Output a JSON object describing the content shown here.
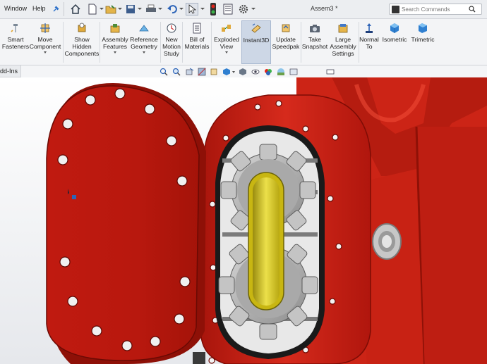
{
  "menu": {
    "window_label": "Window",
    "help_label": "Help"
  },
  "document": {
    "title": "Assem3 *"
  },
  "search": {
    "placeholder": "Search Commands"
  },
  "commands": [
    {
      "label": "Smart\nFasteners",
      "icon": "smart-fasteners-icon"
    },
    {
      "label": "Move\nComponent",
      "icon": "move-component-icon"
    },
    {
      "label": "Show\nHidden\nComponents",
      "icon": "show-hidden-components-icon"
    },
    {
      "label": "Assembly\nFeatures",
      "icon": "assembly-features-icon"
    },
    {
      "label": "Reference\nGeometry",
      "icon": "reference-geometry-icon"
    },
    {
      "label": "New\nMotion\nStudy",
      "icon": "motion-study-icon"
    },
    {
      "label": "Bill of\nMaterials",
      "icon": "bill-of-materials-icon"
    },
    {
      "label": "Exploded\nView",
      "icon": "exploded-view-icon"
    },
    {
      "label": "Instant3D",
      "icon": "instant3d-icon"
    },
    {
      "label": "Update\nSpeedpak",
      "icon": "update-speedpak-icon"
    },
    {
      "label": "Take\nSnapshot",
      "icon": "camera-icon"
    },
    {
      "label": "Large\nAssembly\nSettings",
      "icon": "large-assembly-icon"
    },
    {
      "label": "Normal\nTo",
      "icon": "normal-to-icon"
    },
    {
      "label": "Isometric",
      "icon": "isometric-icon"
    },
    {
      "label": "Trimetric",
      "icon": "trimetric-icon"
    }
  ],
  "tabs": {
    "addins_label": "dd-Ins"
  },
  "colors": {
    "part_red": "#d81f14",
    "part_dark_red": "#9e1209",
    "gear_gray": "#b9b9b9",
    "shaft_yellow": "#e3d21a",
    "active_cmd": "#cdd7e6"
  }
}
